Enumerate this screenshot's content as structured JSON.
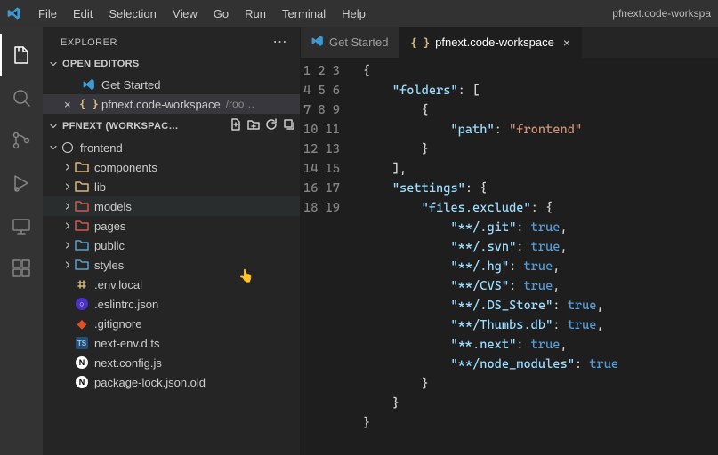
{
  "window": {
    "title": "pfnext.code-workspa"
  },
  "menu": [
    "File",
    "Edit",
    "Selection",
    "View",
    "Go",
    "Run",
    "Terminal",
    "Help"
  ],
  "activity": {
    "items": [
      {
        "name": "files",
        "active": true
      },
      {
        "name": "search",
        "active": false
      },
      {
        "name": "source-control",
        "active": false
      },
      {
        "name": "run-debug",
        "active": false
      },
      {
        "name": "remote",
        "active": false
      },
      {
        "name": "extensions",
        "active": false
      }
    ]
  },
  "sidebar": {
    "title": "EXPLORER",
    "openEditors": {
      "label": "OPEN EDITORS",
      "items": [
        {
          "name": "Get Started"
        },
        {
          "name": "pfnext.code-workspace",
          "meta": "/roo…"
        }
      ]
    },
    "workspace": {
      "label": "PFNEXT (WORKSPAC…",
      "root": {
        "name": "frontend"
      },
      "tree": [
        {
          "name": "components",
          "type": "folder",
          "color": "yellow"
        },
        {
          "name": "lib",
          "type": "folder",
          "color": "yellow"
        },
        {
          "name": "models",
          "type": "folder",
          "color": "red",
          "hover": true
        },
        {
          "name": "pages",
          "type": "folder",
          "color": "red"
        },
        {
          "name": "public",
          "type": "folder",
          "color": "blue"
        },
        {
          "name": "styles",
          "type": "folder",
          "color": "blue"
        },
        {
          "name": ".env.local",
          "type": "file",
          "icon": "env"
        },
        {
          "name": ".eslintrc.json",
          "type": "file",
          "icon": "eslint"
        },
        {
          "name": ".gitignore",
          "type": "file",
          "icon": "git"
        },
        {
          "name": "next-env.d.ts",
          "type": "file",
          "icon": "ts"
        },
        {
          "name": "next.config.js",
          "type": "file",
          "icon": "nextjs"
        },
        {
          "name": "package-lock.json.old",
          "type": "file",
          "icon": "nextjs"
        }
      ]
    }
  },
  "tabs": [
    {
      "label": "Get Started",
      "active": false,
      "icon": "vscode"
    },
    {
      "label": "pfnext.code-workspace",
      "active": true,
      "icon": "braces",
      "closable": true
    }
  ],
  "code": {
    "lines": 19,
    "raw": [
      "{",
      "    \"folders\": [",
      "        {",
      "            \"path\": \"frontend\"",
      "        }",
      "    ],",
      "    \"settings\": {",
      "        \"files.exclude\": {",
      "            \"**/.git\": true,",
      "            \"**/.svn\": true,",
      "            \"**/.hg\": true,",
      "            \"**/CVS\": true,",
      "            \"**/.DS_Store\": true,",
      "            \"**/Thumbs.db\": true,",
      "            \"**.next\": true,",
      "            \"**/node_modules\": true",
      "        }",
      "    }",
      "}"
    ]
  }
}
